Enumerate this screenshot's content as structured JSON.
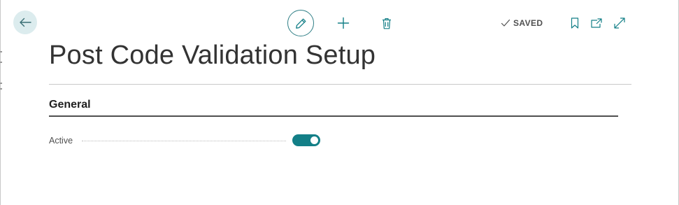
{
  "header": {
    "back_icon": "arrow-left-icon",
    "actions": {
      "edit_icon": "pencil-icon",
      "new_icon": "plus-icon",
      "delete_icon": "trash-icon",
      "bookmark_icon": "bookmark-icon",
      "popout_icon": "open-in-new-window-icon",
      "expand_icon": "expand-icon"
    },
    "status": {
      "icon": "checkmark-icon",
      "label": "SAVED"
    }
  },
  "page": {
    "title": "Post Code Validation Setup"
  },
  "groups": [
    {
      "title": "General",
      "fields": [
        {
          "label": "Active",
          "type": "toggle",
          "value": true
        }
      ]
    }
  ],
  "colors": {
    "accent": "#137f87",
    "back_button_bg": "#dcecee",
    "text_primary": "#212121",
    "text_secondary": "#505050"
  }
}
